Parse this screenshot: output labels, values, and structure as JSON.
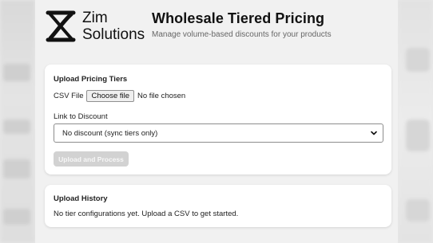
{
  "header": {
    "logo_line1": "Zim",
    "logo_line2": "Solutions",
    "title": "Wholesale Tiered Pricing",
    "subtitle": "Manage volume-based discounts for your products"
  },
  "upload": {
    "section_title": "Upload Pricing Tiers",
    "csv_label": "CSV File",
    "choose_file_label": "Choose file",
    "file_status": "No file chosen",
    "link_label": "Link to Discount",
    "discount_selected": "No discount (sync tiers only)",
    "process_button": "Upload and Process",
    "process_disabled": true
  },
  "history": {
    "section_title": "Upload History",
    "empty_message": "No tier configurations yet. Upload a CSV to get started."
  },
  "colors": {
    "card_background": "#ffffff",
    "page_background": "#f1f1f1",
    "disabled_button": "#d2d2d2"
  },
  "icons": {
    "logo": "zim-logo-icon",
    "select_chevron": "chevron-down-icon"
  }
}
